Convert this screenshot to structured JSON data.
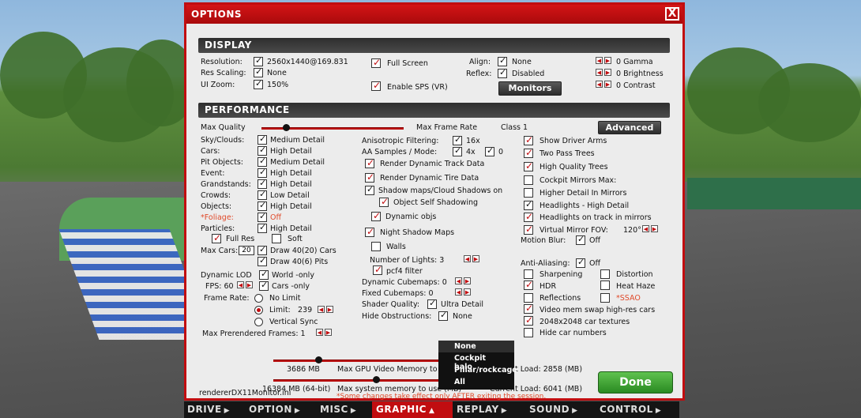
{
  "window": {
    "title": "OPTIONS",
    "close_label": "X"
  },
  "sections": {
    "display": "DISPLAY",
    "performance": "PERFORMANCE"
  },
  "display": {
    "resolution_label": "Resolution:",
    "resolution_value": "2560x1440@169.831",
    "res_scaling_label": "Res Scaling:",
    "res_scaling_value": "None",
    "ui_zoom_label": "UI Zoom:",
    "ui_zoom_value": "150%",
    "full_screen": "Full Screen",
    "enable_sps": "Enable SPS (VR)",
    "align_label": "Align:",
    "align_value": "None",
    "reflex_label": "Reflex:",
    "reflex_value": "Disabled",
    "monitors_button": "Monitors",
    "gamma": "0 Gamma",
    "brightness": "0 Brightness",
    "contrast": "0 Contrast"
  },
  "performance": {
    "max_quality": "Max Quality",
    "max_frame_rate": "Max Frame Rate",
    "class": "Class 1",
    "advanced_button": "Advanced",
    "left_rows": [
      {
        "label": "Sky/Clouds:",
        "value": "Medium Detail"
      },
      {
        "label": "Cars:",
        "value": "High Detail"
      },
      {
        "label": "Pit Objects:",
        "value": "Medium Detail"
      },
      {
        "label": "Event:",
        "value": "High Detail"
      },
      {
        "label": "Grandstands:",
        "value": "High Detail"
      },
      {
        "label": "Crowds:",
        "value": "Low Detail"
      },
      {
        "label": "Objects:",
        "value": "High Detail"
      },
      {
        "label": "*Foliage:",
        "value": "Off"
      },
      {
        "label": "Particles:",
        "value": "High Detail"
      }
    ],
    "full_res": "Full Res",
    "soft": "Soft",
    "max_cars_label": "Max Cars:",
    "max_cars_value": "20",
    "draw_40_20": "Draw 40(20) Cars",
    "draw_40_6": "Draw 40(6) Pits",
    "dynamic_lod": "Dynamic LOD",
    "world_only": "World -only",
    "fps": "FPS: 60",
    "cars_only": "Cars -only",
    "frame_rate": "Frame Rate:",
    "no_limit": "No Limit",
    "limit": "Limit:",
    "limit_value": "239",
    "vertical_sync": "Vertical Sync",
    "max_prerendered": "Max Prerendered Frames: 1",
    "aniso": "Anisotropic Filtering:",
    "aniso_value": "16x",
    "aa_samples": "AA Samples / Mode:",
    "aa_value": "4x",
    "aa_mode": "0",
    "render_track": "Render Dynamic Track Data",
    "render_tire": "Render Dynamic Tire Data",
    "shadow_maps": "Shadow maps/Cloud Shadows on",
    "object_self": "Object Self Shadowing",
    "dynamic_objs": "Dynamic objs",
    "night_shadow": "Night Shadow Maps",
    "walls": "Walls",
    "num_lights": "Number of Lights: 3",
    "pcf4": "pcf4 filter",
    "dyn_cubemaps": "Dynamic Cubemaps: 0",
    "fixed_cubemaps": "Fixed Cubemaps: 0",
    "shader_quality": "Shader Quality:",
    "shader_value": "Ultra Detail",
    "hide_obstructions": "Hide Obstructions:",
    "hide_value": "None",
    "dropdown": [
      "None",
      "Cockpit halo",
      "Pillar/rockcage",
      "All"
    ],
    "show_driver_arms": "Show Driver Arms",
    "two_pass_trees": "Two Pass Trees",
    "hq_trees": "High Quality Trees",
    "cockpit_mirrors": "Cockpit Mirrors  Max:",
    "higher_detail_mirrors": "Higher Detail In Mirrors",
    "headlights_high": "Headlights - High Detail",
    "headlights_track": "Headlights on track in mirrors",
    "virtual_mirror": "Virtual Mirror   FOV:",
    "fov_value": "120°",
    "motion_blur": "Motion Blur:",
    "motion_blur_value": "Off",
    "anti_aliasing": "Anti-Aliasing:",
    "aa_off": "Off",
    "sharpening": "Sharpening",
    "distortion": "Distortion",
    "hdr": "HDR",
    "heat_haze": "Heat Haze",
    "reflections": "Reflections",
    "ssao": "*SSAO",
    "video_mem_swap": "Video mem swap high-res cars",
    "car_textures": "2048x2048 car textures",
    "hide_car_numbers": "Hide car numbers",
    "gpu_mem": "3686 MB",
    "gpu_mem_label": "Max GPU Video Memory to use (MB)",
    "current_load_1": "Current Load: 2858 (MB)",
    "sys_mem": "16384 MB (64-bit)",
    "sys_mem_label": "Max system memory to use (MB)",
    "current_load_2": "Current Load: 6041 (MB)",
    "renderer": "rendererDX11Monitor.ini",
    "note": "*Some changes take effect only AFTER exiting the session."
  },
  "done_button": "Done",
  "nav": [
    "DRIVE",
    "OPTION",
    "MISC",
    "GRAPHIC",
    "REPLAY",
    "SOUND",
    "CONTROL"
  ],
  "colors": {
    "accent_red": "#c10d10",
    "done_green": "#3aa22e",
    "section_dark": "#333333"
  }
}
